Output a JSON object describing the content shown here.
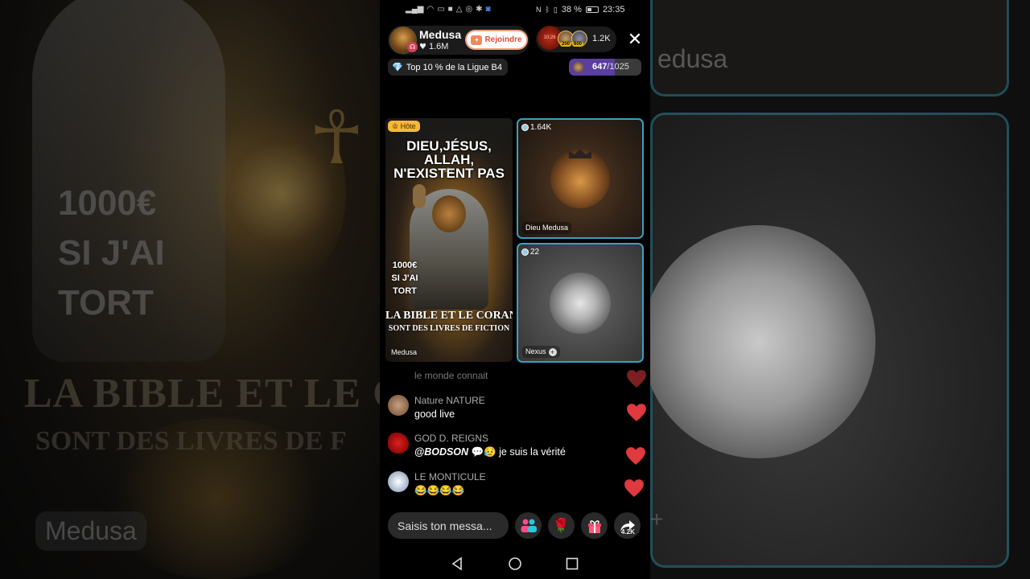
{
  "background": {
    "left_text_lines": [
      "1000€",
      "SI J'AI",
      "TORT"
    ],
    "left_bottom_line1": "LA BIBLE ET LE CO",
    "left_bottom_line2": "SONT DES LIVRES DE F",
    "left_name": "Medusa",
    "right_name": "edusa",
    "right_plus": "+"
  },
  "status_bar": {
    "left_icons": [
      "signal-icon",
      "wifi-icon",
      "cast-icon",
      "video-icon",
      "warning-icon",
      "app-icon",
      "app-icon",
      "shield-icon"
    ],
    "battery_percent": "38 %",
    "time": "23:35"
  },
  "host": {
    "name": "Medusa",
    "likes": "1.6M",
    "join_label": "Rejoindre"
  },
  "viewers": {
    "live_time": "10:26",
    "badge1": "200",
    "badge2": "600",
    "count": "1.2K"
  },
  "league": {
    "label": "Top 10 % de la Ligue B4"
  },
  "score": {
    "current": "647",
    "total": "/1025",
    "progress": 0.63
  },
  "host_tile": {
    "role_badge": "Hôte",
    "poster_title": [
      "DIEU,JÉSUS,",
      "ALLAH,",
      "N'EXISTENT PAS"
    ],
    "poster_claim": [
      "1000€",
      "SI J'AI",
      "TORT"
    ],
    "poster_bottom1": "LA BIBLE ET LE CORAN",
    "poster_bottom2": "SONT DES LIVRES DE FICTION",
    "name": "Medusa"
  },
  "guests": [
    {
      "count": "1.64K",
      "name": "Dieu Medusa"
    },
    {
      "count": "22",
      "name": "Nexus"
    }
  ],
  "chat": {
    "faded_line": "le monde connait",
    "messages": [
      {
        "user": "Nature NATURE",
        "text": "good live"
      },
      {
        "user": "GOD D. REIGNS",
        "mention": "@BODSON",
        "text": "💬😥 je suis la vérité"
      },
      {
        "user": "LE MONTICULE",
        "text": "😂😂😂😂"
      }
    ]
  },
  "composer": {
    "placeholder": "Saisis ton messa..."
  },
  "share_count": "4.2K",
  "colors": {
    "accent_border": "#3aa0c0",
    "heart": "#e0393e",
    "join_text": "#e0503a",
    "score_fill": "#5a3fa0"
  }
}
